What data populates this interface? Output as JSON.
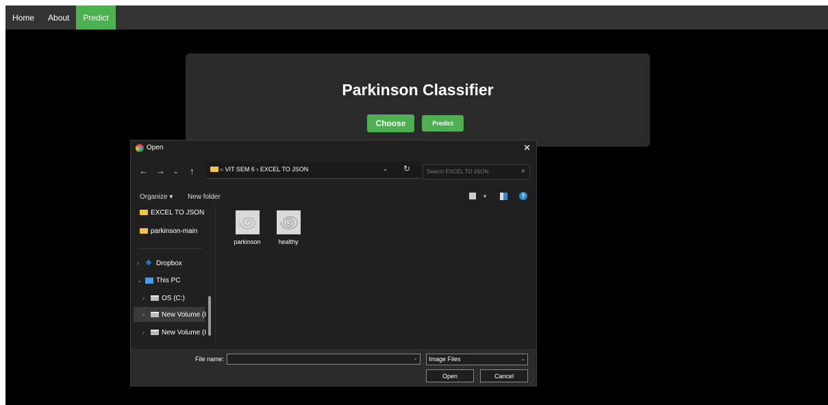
{
  "nav": {
    "items": [
      {
        "label": "Home"
      },
      {
        "label": "About"
      },
      {
        "label": "Predict",
        "active": true
      }
    ],
    "background": "#333333",
    "active_color": "#4CAF50"
  },
  "card": {
    "title": "Parkinson Classifier",
    "choose_label": "Choose",
    "predict_label": "Predict"
  },
  "dialog": {
    "title": "Open",
    "close_glyph": "✕",
    "address": {
      "overflow": "«",
      "segment1": "VIT SEM 6",
      "separator": "›",
      "segment2": "EXCEL TO JSON"
    },
    "search_placeholder": "Search EXCEL TO JSON",
    "toolbar": {
      "organize": "Organize ▾",
      "new_folder": "New folder"
    },
    "nav_pane": [
      {
        "label": "EXCEL TO JSON",
        "icon": "folder-icon"
      },
      {
        "label": "parkinson-main",
        "icon": "folder-icon"
      },
      {
        "label": "Dropbox",
        "icon": "dropbox-icon",
        "chevron": "›"
      },
      {
        "label": "This PC",
        "icon": "pc-icon",
        "chevron": "⌄"
      },
      {
        "label": "OS (C:)",
        "icon": "drive-icon",
        "chevron": "›"
      },
      {
        "label": "New Volume (I",
        "icon": "drive-icon",
        "chevron": "›",
        "selected": true
      },
      {
        "label": "New Volume (I",
        "icon": "drive-icon",
        "chevron": "›"
      }
    ],
    "files": [
      {
        "label": "parkinson"
      },
      {
        "label": "healthy"
      }
    ],
    "footer": {
      "file_name_label": "File name:",
      "file_name_value": "",
      "file_type": "Image Files",
      "open_label": "Open",
      "cancel_label": "Cancel"
    }
  }
}
